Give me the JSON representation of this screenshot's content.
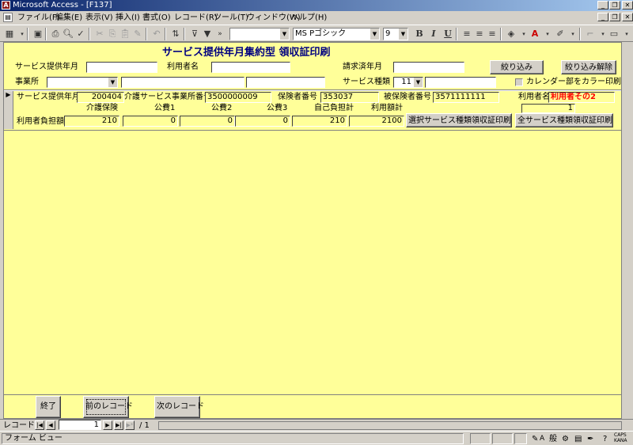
{
  "window": {
    "title": "Microsoft Access - [F137]",
    "app_icon": "access-icon"
  },
  "menu": [
    "ファイル(F)",
    "編集(E)",
    "表示(V)",
    "挿入(I)",
    "書式(O)",
    "レコード(R)",
    "ツール(T)",
    "ウィンドウ(W)",
    "ヘルプ(H)"
  ],
  "toolbar": {
    "object_combo": "",
    "font_name": "MS Pゴシック",
    "font_size": "9",
    "bold": "B",
    "italic": "I",
    "underline": "U"
  },
  "form": {
    "title": "サービス提供年月集約型 領収証印刷",
    "filter": {
      "service_month_label": "サービス提供年月",
      "service_month_value": "",
      "user_name_label": "利用者名",
      "user_name_value": "",
      "billed_month_label": "請求済年月",
      "billed_month_value": "",
      "filter_button": "絞り込み",
      "filter_clear_button": "絞り込み解除",
      "office_label": "事業所",
      "office_value": "",
      "office_field2": "",
      "office_field3": "",
      "service_type_label": "サービス種類",
      "service_type_value": "11",
      "service_type_name": "",
      "calendar_color_label": "カレンダー部をカラー印刷"
    },
    "record": {
      "service_month_label": "サービス提供年月",
      "service_month_value": "200404",
      "provider_no_label": "介護サービス事業所番号",
      "provider_no_value": "3500000009",
      "insurer_no_label": "保険者番号",
      "insurer_no_value": "353037",
      "insured_no_label": "被保険者番号",
      "insured_no_value": "3571111111",
      "user_name_label": "利用者名",
      "user_name_value": "利用者その2",
      "count_value": "1",
      "col_headers": [
        "介護保険",
        "公費1",
        "公費2",
        "公費3",
        "自己負担計",
        "利用額計"
      ],
      "burden_label": "利用者負担額",
      "burden_values": [
        "210",
        "0",
        "0",
        "0",
        "210",
        "2100"
      ],
      "print_selected_button": "選択サービス種類領収証印刷",
      "print_all_button": "全サービス種類領収証印刷"
    },
    "footer": {
      "exit_button": "終了",
      "prev_button": "前のレコード",
      "next_button": "次のレコード"
    }
  },
  "navigator": {
    "label": "レコード:",
    "current": "1",
    "total": "/ 1"
  },
  "status": {
    "view": "フォーム ビュー",
    "ime_mode": "般",
    "caps": "CAPS KANA"
  }
}
